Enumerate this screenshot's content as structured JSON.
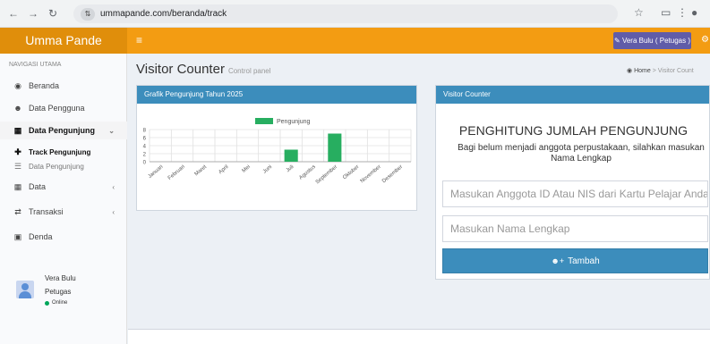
{
  "browser": {
    "url": "ummapande.com/beranda/track",
    "icons": [
      "back-arrow",
      "forward-arrow",
      "reload",
      "site-settings",
      "bookmark-star",
      "extensions",
      "menu",
      "profile"
    ]
  },
  "header": {
    "brand": "Umma Pande",
    "user_button": "Vera Bulu ( Petugas )",
    "colors": {
      "bar": "#f39c12",
      "logo": "#e08e0b",
      "user_button": "#605ca8"
    }
  },
  "sidebar": {
    "section": "NAVIGASI UTAMA",
    "items": [
      {
        "label": "Beranda",
        "icon": "dashboard-icon"
      },
      {
        "label": "Data Pengguna",
        "icon": "users-icon"
      },
      {
        "label": "Data Pengunjung",
        "icon": "edit-icon",
        "expanded": true
      },
      {
        "label": "Track Pengunjung",
        "icon": "plus-icon"
      },
      {
        "label": "Data Pengunjung",
        "icon": "list-icon"
      },
      {
        "label": "Data",
        "icon": "edit-icon"
      },
      {
        "label": "Transaksi",
        "icon": "exchange-icon"
      },
      {
        "label": "Denda",
        "icon": "money-icon"
      }
    ],
    "user": {
      "name": "Vera Bulu",
      "role": "Petugas",
      "status": "Online"
    }
  },
  "main": {
    "title": "Visitor Counter",
    "subtitle": "Control panel",
    "breadcrumb": {
      "home": "Home",
      "current": "Visitor Count"
    }
  },
  "chart_box": {
    "title": "Grafik Pengunjung Tahun 2025"
  },
  "chart_data": {
    "type": "bar",
    "categories": [
      "Januari",
      "Februari",
      "Maret",
      "April",
      "Mei",
      "Juni",
      "Juli",
      "Agustus",
      "September",
      "Oktober",
      "November",
      "Desember"
    ],
    "series": [
      {
        "name": "Pengunjung",
        "values": [
          0,
          0,
          0,
          0,
          0,
          0,
          3,
          0,
          7,
          0,
          0,
          0
        ],
        "color": "#27ae60"
      }
    ],
    "y_ticks": [
      0,
      2,
      4,
      6,
      8
    ],
    "ylim": [
      0,
      8
    ],
    "grid": true,
    "legend": "top"
  },
  "visitor_box": {
    "title": "Visitor Counter",
    "heading": "PENGHITUNG JUMLAH PENGUNJUNG",
    "description": "Bagi belum menjadi anggota perpustakaan, silahkan masukan Nama Lengkap",
    "id_placeholder": "Masukan Anggota ID Atau NIS dari Kartu Pelajar Anda",
    "name_placeholder": "Masukan Nama Lengkap",
    "submit_label": "Tambah",
    "accent": "#3c8dbc"
  }
}
